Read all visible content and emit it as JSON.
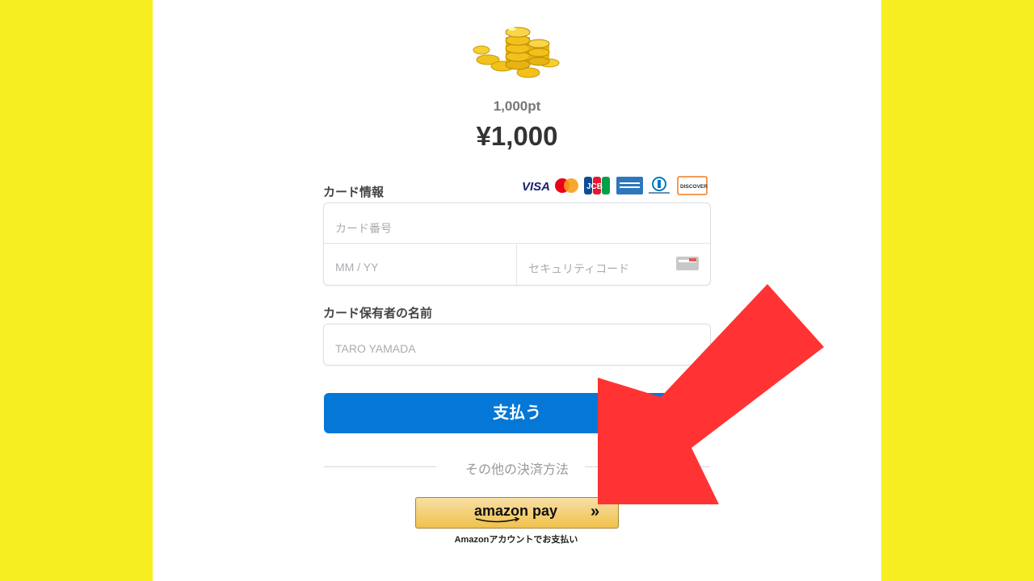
{
  "product": {
    "points": "1,000pt",
    "price": "¥1,000"
  },
  "card_section": {
    "label": "カード情報",
    "brands": [
      "VISA",
      "Mastercard",
      "JCB",
      "American Express",
      "Diners Club",
      "DISCOVER"
    ],
    "visa_text": "VISA",
    "discover_text": "DISCOVER",
    "jcb_text": "JCB",
    "number_placeholder": "カード番号",
    "expiry_placeholder": "MM / YY",
    "cvc_placeholder": "セキュリティコード"
  },
  "holder_section": {
    "label": "カード保有者の名前",
    "name_placeholder": "TARO YAMADA"
  },
  "pay_button": {
    "label": "支払う",
    "color": "#0577d6"
  },
  "other_methods": {
    "label": "その他の決済方法"
  },
  "amazon_pay": {
    "logo_text": "amazon pay",
    "chevron": "»",
    "subtext": "Amazonアカウントでお支払い"
  },
  "colors": {
    "background": "#f7ee22",
    "arrow": "#ff3333"
  },
  "icons": [
    "coins-icon",
    "cvc-card-icon",
    "chevron-right-icon",
    "red-arrow-annotation"
  ]
}
